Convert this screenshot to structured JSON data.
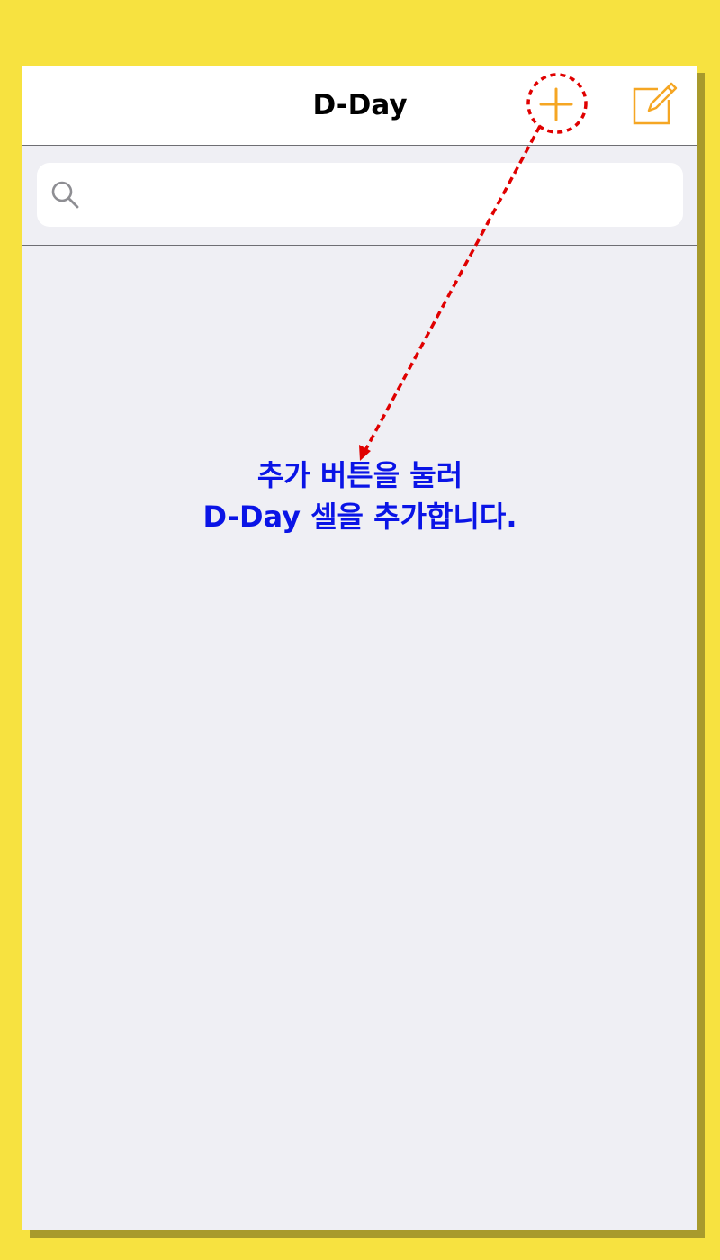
{
  "navbar": {
    "title": "D-Day",
    "add_button_icon": "plus-icon",
    "compose_button_icon": "compose-icon"
  },
  "search": {
    "icon": "search-icon",
    "value": "",
    "placeholder": ""
  },
  "annotation": {
    "line1": "추가 버튼을 눌러",
    "line2": "D-Day 셀을 추가합니다."
  },
  "colors": {
    "background": "#f7e240",
    "accent": "#f5a623",
    "annotation_text": "#0a14e6",
    "annotation_arrow": "#e00000"
  }
}
